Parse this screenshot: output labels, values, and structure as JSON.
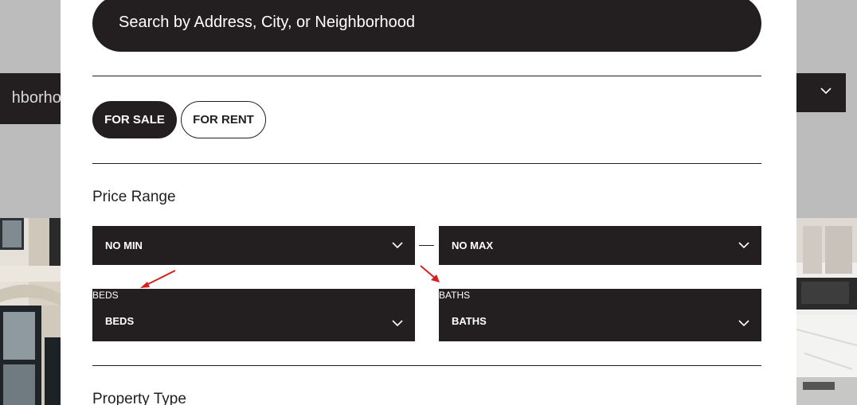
{
  "background": {
    "search_text_fragment": "hborhoo"
  },
  "modal": {
    "search": {
      "placeholder": "Search by Address, City, or Neighborhood"
    },
    "listing_type": {
      "for_sale_label": "FOR SALE",
      "for_rent_label": "FOR RENT",
      "selected": "FOR SALE"
    },
    "price_range": {
      "title": "Price Range",
      "min_value": "NO MIN",
      "max_value": "NO MAX"
    },
    "beds": {
      "label": "BEDS",
      "value": "BEDS"
    },
    "baths": {
      "label": "BATHS",
      "value": "BATHS"
    },
    "property_type": {
      "title": "Property Type"
    }
  },
  "colors": {
    "dark": "#231f20",
    "overlay": "#bdbcbc",
    "annotation_arrow": "#d6201f"
  },
  "icons": {
    "dropdown": "chevron-down-icon",
    "annotation": "red-arrow-icon"
  }
}
